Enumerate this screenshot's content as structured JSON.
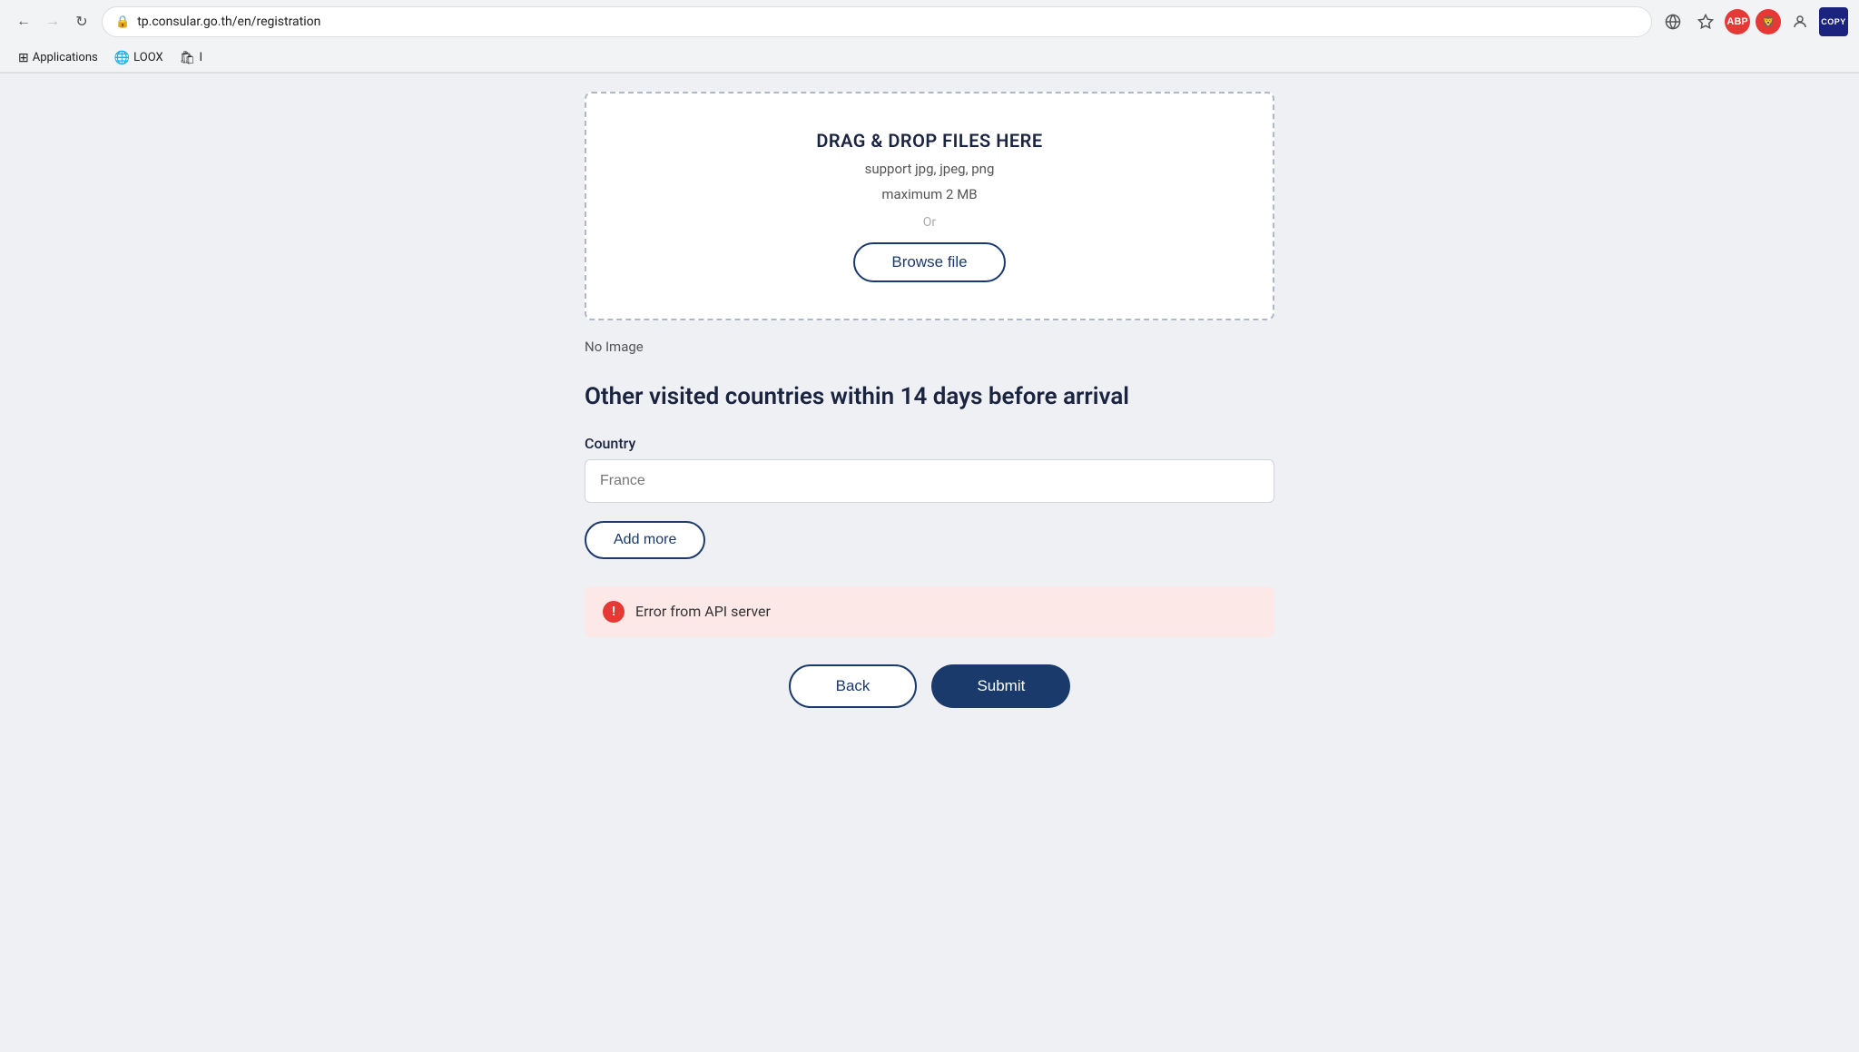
{
  "browser": {
    "url": "tp.consular.go.th/en/registration",
    "back_disabled": false,
    "forward_disabled": true
  },
  "bookmarks": {
    "items": [
      {
        "id": "apps",
        "label": "Applications",
        "icon": "⊞"
      },
      {
        "id": "loox",
        "label": "LOOX",
        "icon": "🌐"
      },
      {
        "id": "shopify",
        "label": "I",
        "icon": "🛍"
      }
    ]
  },
  "extensions": {
    "translate_title": "Google Translate",
    "star_title": "Bookmark",
    "abp_label": "ABP",
    "brave_label": "🦁",
    "lock_label": "🔒",
    "copy_label": "COPY"
  },
  "dropzone": {
    "title": "DRAG & DROP FILES HERE",
    "support_text": "support jpg, jpeg, png",
    "max_text": "maximum 2 MB",
    "or_text": "Or",
    "browse_label": "Browse file"
  },
  "no_image": {
    "label": "No Image"
  },
  "section": {
    "heading": "Other visited countries within 14 days before arrival"
  },
  "country_field": {
    "label": "Country",
    "placeholder": "France"
  },
  "add_more": {
    "label": "Add more"
  },
  "error": {
    "message": "Error from API server"
  },
  "buttons": {
    "back": "Back",
    "submit": "Submit"
  }
}
